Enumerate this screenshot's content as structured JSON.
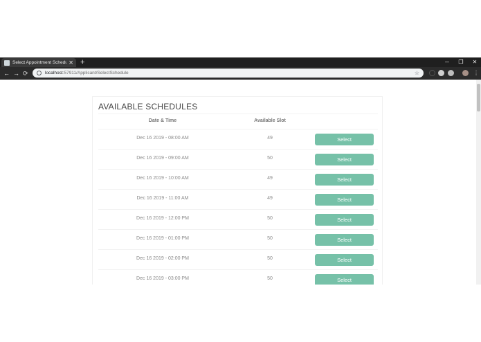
{
  "browser": {
    "tab_title": "Select Appointment Schedule - ",
    "tab_close": "✕",
    "new_tab": "+",
    "window_controls": {
      "minimize": "─",
      "maximize": "❐",
      "close": "✕"
    },
    "nav": {
      "back": "←",
      "forward": "→",
      "reload": "⟳"
    },
    "url_host": "localhost",
    "url_rest": ":57911/Applicant/SelectSchedule",
    "star": "☆",
    "menu": "⋮"
  },
  "page": {
    "title": "AVAILABLE SCHEDULES",
    "columns": {
      "datetime": "Date & Time",
      "slot": "Available Slot"
    },
    "rows": [
      {
        "datetime": "Dec 16 2019 - 08:00 AM",
        "slot": "49",
        "action": "Select"
      },
      {
        "datetime": "Dec 16 2019 - 09:00 AM",
        "slot": "50",
        "action": "Select"
      },
      {
        "datetime": "Dec 16 2019 - 10:00 AM",
        "slot": "49",
        "action": "Select"
      },
      {
        "datetime": "Dec 16 2019 - 11:00 AM",
        "slot": "49",
        "action": "Select"
      },
      {
        "datetime": "Dec 16 2019 - 12:00 PM",
        "slot": "50",
        "action": "Select"
      },
      {
        "datetime": "Dec 16 2019 - 01:00 PM",
        "slot": "50",
        "action": "Select"
      },
      {
        "datetime": "Dec 16 2019 - 02:00 PM",
        "slot": "50",
        "action": "Select"
      },
      {
        "datetime": "Dec 16 2019 - 03:00 PM",
        "slot": "50",
        "action": "Select"
      }
    ]
  },
  "colors": {
    "accent": "#76c1a8",
    "chrome_dark": "#1f1f1f"
  }
}
